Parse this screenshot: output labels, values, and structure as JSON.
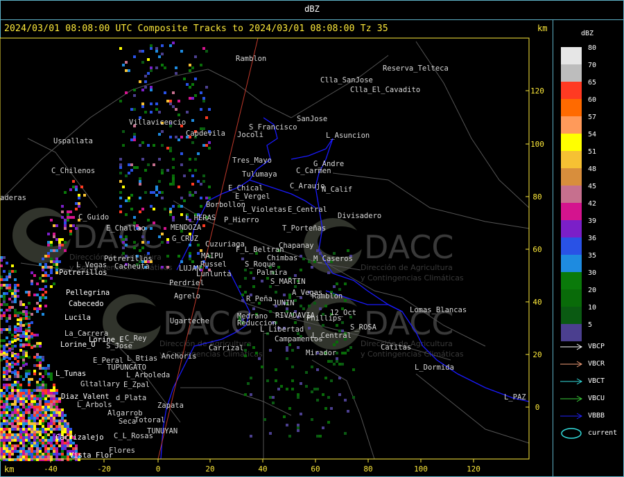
{
  "window": {
    "title": "dBZ"
  },
  "header": {
    "subtitle": "2024/03/01 08:08:00 UTC Composite Tracks to 2024/03/01 08:08:00 Tz 35",
    "km_label_top": "km",
    "km_label_bottom": "km"
  },
  "axes": {
    "x_ticks": [
      "-40",
      "-20",
      "0",
      "20",
      "40",
      "60",
      "80",
      "100",
      "120"
    ],
    "y_ticks": [
      "120",
      "100",
      "80",
      "60",
      "40",
      "20",
      "0"
    ]
  },
  "colors": {
    "frame": "#5fb3c8",
    "axis_text": "#ffeb3b",
    "boundary": "#1a1aff",
    "track": "#c0392b"
  },
  "legend": {
    "title": "dBZ",
    "scale": [
      {
        "label": "80",
        "color": "#e6e6e6"
      },
      {
        "label": "70",
        "color": "#bdbdbd"
      },
      {
        "label": "65",
        "color": "#ff3a22"
      },
      {
        "label": "60",
        "color": "#ff6a00"
      },
      {
        "label": "57",
        "color": "#ff9a5a"
      },
      {
        "label": "54",
        "color": "#ffff00"
      },
      {
        "label": "51",
        "color": "#f6c133"
      },
      {
        "label": "48",
        "color": "#d88e3c"
      },
      {
        "label": "45",
        "color": "#c6708e"
      },
      {
        "label": "42",
        "color": "#d4148e"
      },
      {
        "label": "39",
        "color": "#7b1fc8"
      },
      {
        "label": "36",
        "color": "#2952e6"
      },
      {
        "label": "35",
        "color": "#1e8be0"
      },
      {
        "label": "30",
        "color": "#0a7a0a"
      },
      {
        "label": "20",
        "color": "#096b09"
      },
      {
        "label": "10",
        "color": "#0a5a12"
      },
      {
        "label": "5",
        "color": "#4b3f8f"
      }
    ],
    "tracks": [
      {
        "label": "VBCP",
        "color": "#ffffff"
      },
      {
        "label": "VBCR",
        "color": "#f4a07a"
      },
      {
        "label": "VBCT",
        "color": "#33dddd"
      },
      {
        "label": "VBCU",
        "color": "#3ad13a"
      },
      {
        "label": "VBBB",
        "color": "#2222ff"
      }
    ],
    "current_label": "current"
  },
  "watermarks": [
    {
      "text": "DACC",
      "sub1": "Dirección de Agricultura",
      "sub2": "y Contingencias Climáticas"
    },
    {
      "text": "DACC",
      "sub1": "Dirección de Agricultura",
      "sub2": "y Contingencias Climáticas"
    },
    {
      "text": "DACC",
      "sub1": "Dirección de Agricultura",
      "sub2": "y Contingencias Climáticas"
    },
    {
      "text": "DACC",
      "sub1": "Dirección de Agricultura",
      "sub2": "y Contingencias Climáticas"
    }
  ],
  "places": [
    {
      "name": "Ramblon",
      "white": false
    },
    {
      "name": "Reserva_Telteca",
      "white": false
    },
    {
      "name": "Clla_SanJose",
      "white": false
    },
    {
      "name": "Clla_El_Cavadito",
      "white": false
    },
    {
      "name": "SanJose",
      "white": false
    },
    {
      "name": "S_Francisco",
      "white": false
    },
    {
      "name": "Uspallata",
      "white": false
    },
    {
      "name": "Villavicencio",
      "white": false
    },
    {
      "name": "Capdevila",
      "white": false
    },
    {
      "name": "Jocoli",
      "white": false
    },
    {
      "name": "L_Asuncion",
      "white": false
    },
    {
      "name": "Tres_Mayo",
      "white": false
    },
    {
      "name": "G_Andre",
      "white": false
    },
    {
      "name": "C_Carmen",
      "white": false
    },
    {
      "name": "C_Chilenos",
      "white": false
    },
    {
      "name": "Tulumaya",
      "white": false
    },
    {
      "name": "E_Chical",
      "white": false
    },
    {
      "name": "C_Araujo",
      "white": false
    },
    {
      "name": "N_Calif",
      "white": false
    },
    {
      "name": "E_Vergel",
      "white": false
    },
    {
      "name": "aderas",
      "white": false
    },
    {
      "name": "Borbollon",
      "white": false
    },
    {
      "name": "L_Violetas",
      "white": false
    },
    {
      "name": "E_Central",
      "white": false
    },
    {
      "name": "Divisadero",
      "white": false
    },
    {
      "name": "C_Guido",
      "white": false
    },
    {
      "name": "L_HERAS",
      "white": false
    },
    {
      "name": "P_Hierro",
      "white": false
    },
    {
      "name": "E_Challao",
      "white": false
    },
    {
      "name": "MENDOZA",
      "white": false
    },
    {
      "name": "T_Porteñas",
      "white": false
    },
    {
      "name": "G_CRUZ",
      "white": false
    },
    {
      "name": "Cuzuriaga",
      "white": false
    },
    {
      "name": "Chapanay",
      "white": false
    },
    {
      "name": "F_L_Beltran",
      "white": false
    },
    {
      "name": "MAIPU",
      "white": false
    },
    {
      "name": "Chimbas",
      "white": false
    },
    {
      "name": "M_Caseros",
      "white": false
    },
    {
      "name": "Potrerillos",
      "white": false
    },
    {
      "name": "Russel",
      "white": false
    },
    {
      "name": "S_Roque",
      "white": false
    },
    {
      "name": "L_Vegas",
      "white": false
    },
    {
      "name": "Cacheuta",
      "white": false
    },
    {
      "name": "LUJAN",
      "white": false
    },
    {
      "name": "Palmira",
      "white": false
    },
    {
      "name": "Potrerillos",
      "white": true
    },
    {
      "name": "Lunlunta",
      "white": false
    },
    {
      "name": "S_MARTIN",
      "white": false
    },
    {
      "name": "Perdriel",
      "white": false
    },
    {
      "name": "Pellegrina",
      "white": true
    },
    {
      "name": "A_Vegas",
      "white": false
    },
    {
      "name": "Ramblon",
      "white": false
    },
    {
      "name": "Agrelo",
      "white": false
    },
    {
      "name": "R_Peña",
      "white": false
    },
    {
      "name": "JUNIN",
      "white": false
    },
    {
      "name": "Cabecedo",
      "white": true
    },
    {
      "name": "Lomas_Blancas",
      "white": false
    },
    {
      "name": "12_Oct",
      "white": false
    },
    {
      "name": "Lucila",
      "white": true
    },
    {
      "name": "Medrano",
      "white": false
    },
    {
      "name": "RIVADAVIA",
      "white": false
    },
    {
      "name": "Phillips",
      "white": false
    },
    {
      "name": "Ugarteche",
      "white": false
    },
    {
      "name": "Reduccion",
      "white": false
    },
    {
      "name": "S_ROSA",
      "white": false
    },
    {
      "name": "La_Carrera",
      "white": false
    },
    {
      "name": "L_Libertad",
      "white": false
    },
    {
      "name": "L_Central",
      "white": false
    },
    {
      "name": "Lorine_E",
      "white": true
    },
    {
      "name": "C_Rey",
      "white": false
    },
    {
      "name": "Campamentos",
      "white": false
    },
    {
      "name": "Lorine_O",
      "white": true
    },
    {
      "name": "S_Jose",
      "white": false
    },
    {
      "name": "Catitas",
      "white": false
    },
    {
      "name": "Carrizal",
      "white": false
    },
    {
      "name": "Mirador",
      "white": false
    },
    {
      "name": "Anchoris",
      "white": false
    },
    {
      "name": "E_Peral",
      "white": false
    },
    {
      "name": "L_Btias",
      "white": false
    },
    {
      "name": "L_Dormida",
      "white": false
    },
    {
      "name": "TUPUNGATO",
      "white": false
    },
    {
      "name": "L_Tunas",
      "white": true
    },
    {
      "name": "L_Arboleda",
      "white": false
    },
    {
      "name": "Gltallary",
      "white": false
    },
    {
      "name": "E_Zpal",
      "white": false
    },
    {
      "name": "Diaz_Valent",
      "white": true
    },
    {
      "name": "d_Plata",
      "white": false
    },
    {
      "name": "L_PAZ",
      "white": false
    },
    {
      "name": "L_Arbols",
      "white": false
    },
    {
      "name": "Zapata",
      "white": false
    },
    {
      "name": "Algarrob",
      "white": false
    },
    {
      "name": "Seca",
      "white": false
    },
    {
      "name": "Totoral",
      "white": false
    },
    {
      "name": "Carrizalejo",
      "white": true
    },
    {
      "name": "C_L_Rosas",
      "white": false
    },
    {
      "name": "TUNUYAN",
      "white": false
    },
    {
      "name": "Flores",
      "white": false
    },
    {
      "name": "Vista_Flor",
      "white": true
    }
  ]
}
